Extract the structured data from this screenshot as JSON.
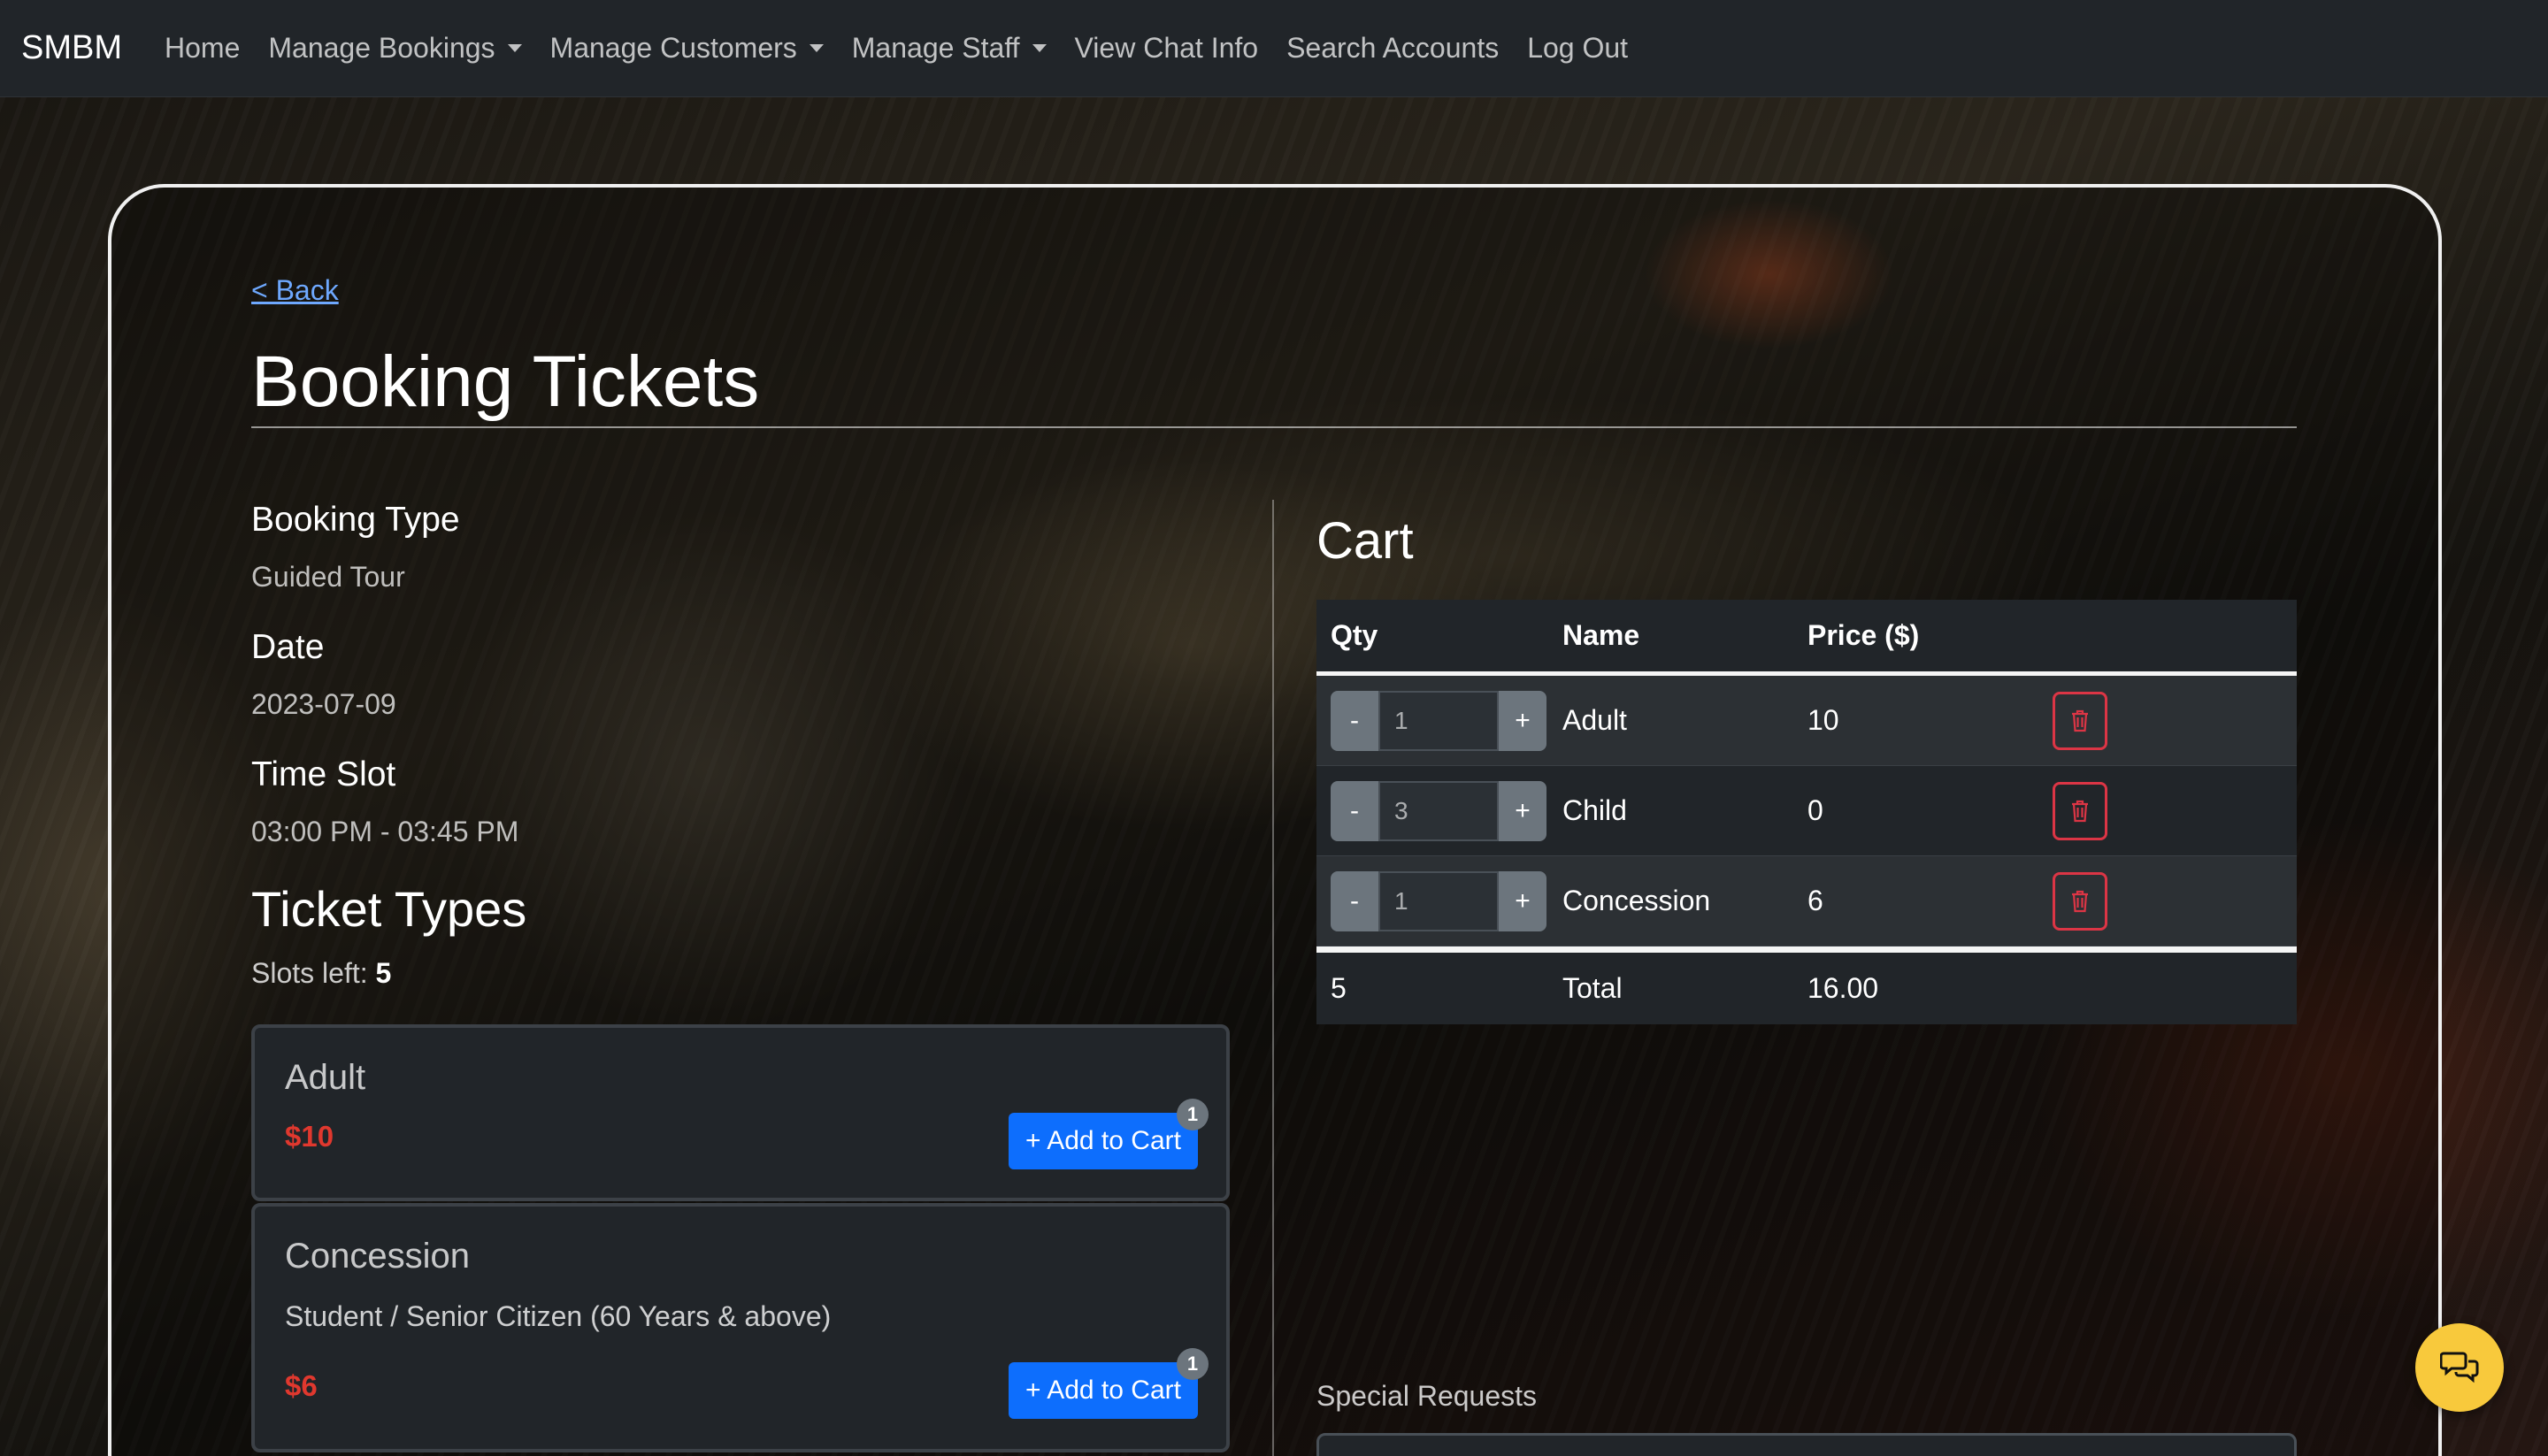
{
  "navbar": {
    "brand": "SMBM",
    "items": [
      {
        "label": "Home",
        "dropdown": false
      },
      {
        "label": "Manage Bookings",
        "dropdown": true
      },
      {
        "label": "Manage Customers",
        "dropdown": true
      },
      {
        "label": "Manage Staff",
        "dropdown": true
      },
      {
        "label": "View Chat Info",
        "dropdown": false
      },
      {
        "label": "Search Accounts",
        "dropdown": false
      },
      {
        "label": "Log Out",
        "dropdown": false
      }
    ]
  },
  "back_link": "< Back",
  "page_title": "Booking Tickets",
  "booking": {
    "type_label": "Booking Type",
    "type_value": "Guided Tour",
    "date_label": "Date",
    "date_value": "2023-07-09",
    "slot_label": "Time Slot",
    "slot_value": "03:00 PM - 03:45 PM"
  },
  "ticket_types": {
    "title": "Ticket Types",
    "slots_left_label": "Slots left: ",
    "slots_left_value": "5",
    "items": [
      {
        "name": "Adult",
        "description": "",
        "price": "$10",
        "button": "+ Add to Cart",
        "badge": "1"
      },
      {
        "name": "Concession",
        "description": "Student / Senior Citizen (60 Years & above)",
        "price": "$6",
        "button": "+ Add to Cart",
        "badge": "1"
      }
    ]
  },
  "cart": {
    "title": "Cart",
    "headers": [
      "Qty",
      "Name",
      "Price ($)"
    ],
    "rows": [
      {
        "qty": "1",
        "name": "Adult",
        "price": "10"
      },
      {
        "qty": "3",
        "name": "Child",
        "price": "0"
      },
      {
        "qty": "1",
        "name": "Concession",
        "price": "6"
      }
    ],
    "stepper_minus": "-",
    "stepper_plus": "+",
    "footer": {
      "qty": "5",
      "label": "Total",
      "price": "16.00"
    }
  },
  "special_requests": {
    "label": "Special Requests"
  },
  "icons": {
    "trash": "trash-icon",
    "chat": "chat-icon",
    "caret": "chevron-down-icon"
  },
  "colors": {
    "accent": "#0d6efd",
    "danger": "#dc3545",
    "price": "#e0382e",
    "chat_fab": "#f8c93c"
  }
}
